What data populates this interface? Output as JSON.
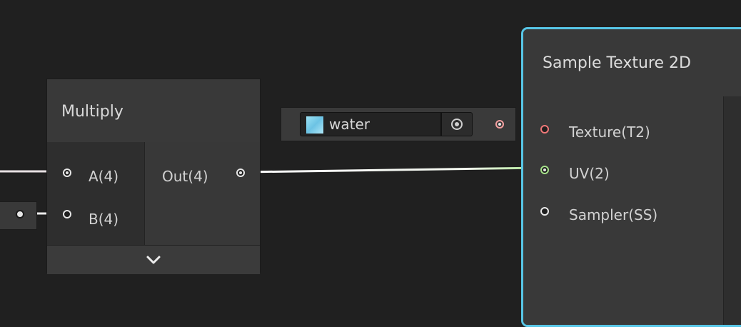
{
  "multiply_node": {
    "title": "Multiply",
    "inputs": [
      "A(4)",
      "B(4)"
    ],
    "output": "Out(4)",
    "expand_icon": "chevron-down-icon"
  },
  "texture_property": {
    "value": "water",
    "thumbnail_icon": "texture-thumbnail-icon",
    "picker_icon": "object-picker-icon"
  },
  "sample_node": {
    "title": "Sample Texture 2D",
    "inputs": [
      "Texture(T2)",
      "UV(2)",
      "Sampler(SS)"
    ]
  },
  "colors": {
    "background": "#202020",
    "node_body": "#393939",
    "selection_outline": "#57c6e6",
    "texture_port": "#f07878",
    "uv_port": "#a6e28a",
    "vector4_wire": "#e2cfd6"
  }
}
